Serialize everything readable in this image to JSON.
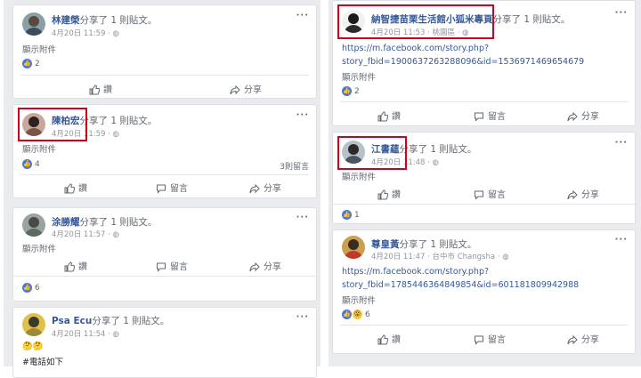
{
  "shared_text": "分享了 1 則貼文。",
  "actions": {
    "like": "讚",
    "comment": "留言",
    "share": "分享"
  },
  "show_attachment": "顯示附件",
  "left_posts": [
    {
      "name": "林建榮",
      "date": "4月20日 11:59 ·",
      "likes": "2"
    },
    {
      "name": "陳柏宏",
      "date": "4月20日 11:59 ·",
      "likes": "4",
      "comments": "3則留言"
    },
    {
      "name": "涂勝耀",
      "date": "4月20日 11:57 ·",
      "likes": "6"
    },
    {
      "name": "Psa Ecu",
      "date": "4月20日 11:54 ·",
      "emoji": "🤔🤔",
      "text": "#電話如下"
    }
  ],
  "right_posts": [
    {
      "name": "納智捷苗栗生活館小狐米專頁",
      "date": "4月20日 11:53 · 桃園區 ·",
      "link1": "https://m.facebook.com/story.php?",
      "link2": "story_fbid=1900637263288096&id=1536971469654679",
      "likes": "2"
    },
    {
      "name": "江書蘊",
      "date": "4月20日 11:48 ·",
      "likes": "1"
    },
    {
      "name": "尊皇黃",
      "date": "4月20日 11:47 · 台中市 Changsha ·",
      "link1": "https://m.facebook.com/story.php?",
      "link2": "story_fbid=1785446364849854&id=601181809942988",
      "likes": "6"
    }
  ],
  "colors": {
    "link": "#365899",
    "highlight": "#d0021b",
    "like": "#4a78d8",
    "background": "#e9ebee"
  }
}
